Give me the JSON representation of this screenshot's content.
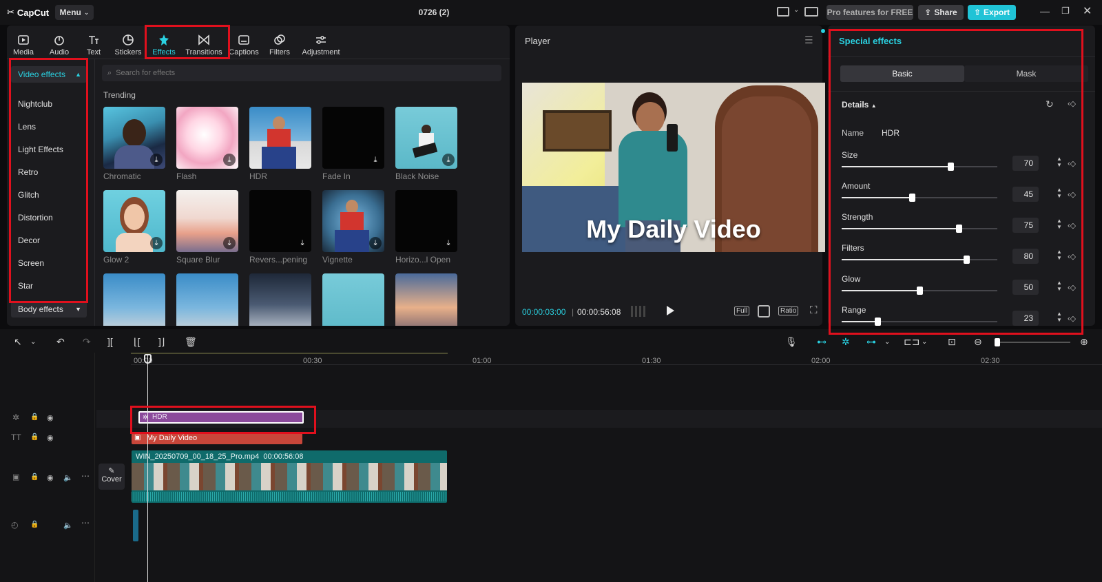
{
  "app": {
    "name": "CapCut",
    "menu_label": "Menu",
    "project_title": "0726 (2)"
  },
  "header": {
    "pro_label": "Pro features for FREE",
    "share_label": "Share",
    "export_label": "Export"
  },
  "toolbar": {
    "tabs": [
      {
        "label": "Media",
        "icon": "media-icon"
      },
      {
        "label": "Audio",
        "icon": "audio-icon"
      },
      {
        "label": "Text",
        "icon": "text-icon"
      },
      {
        "label": "Stickers",
        "icon": "sticker-icon"
      },
      {
        "label": "Effects",
        "icon": "effects-icon",
        "active": true
      },
      {
        "label": "Transitions",
        "icon": "transitions-icon"
      },
      {
        "label": "Captions",
        "icon": "captions-icon"
      },
      {
        "label": "Filters",
        "icon": "filters-icon"
      },
      {
        "label": "Adjustment",
        "icon": "adjustment-icon"
      }
    ]
  },
  "sidebar": {
    "video_effects_label": "Video effects",
    "items": [
      "Nightclub",
      "Lens",
      "Light Effects",
      "Retro",
      "Glitch",
      "Distortion",
      "Decor",
      "Screen",
      "Star"
    ],
    "body_effects_label": "Body effects"
  },
  "effects": {
    "search_placeholder": "Search for effects",
    "section_label": "Trending",
    "items": [
      "Chromatic",
      "Flash",
      "HDR",
      "Fade In",
      "Black Noise",
      "Glow 2",
      "Square Blur",
      "Revers...pening",
      "Vignette",
      "Horizo...l Open"
    ]
  },
  "player": {
    "title": "Player",
    "overlay_text": "My Daily Video",
    "current_time": "00:00:03:00",
    "total_time": "00:00:56:08",
    "full_label": "Full",
    "ratio_label": "Ratio"
  },
  "props": {
    "title": "Special effects",
    "tab_basic": "Basic",
    "tab_mask": "Mask",
    "details_label": "Details",
    "name_label": "Name",
    "name_value": "HDR",
    "sliders": [
      {
        "label": "Size",
        "value": "70",
        "level": 70
      },
      {
        "label": "Amount",
        "value": "45",
        "level": 45
      },
      {
        "label": "Strength",
        "value": "75",
        "level": 75
      },
      {
        "label": "Filters",
        "value": "80",
        "level": 80
      },
      {
        "label": "Glow",
        "value": "50",
        "level": 50
      },
      {
        "label": "Range",
        "value": "23",
        "level": 23
      }
    ]
  },
  "timeline": {
    "ruler": [
      "00:00",
      "00:30",
      "01:00",
      "01:30",
      "02:00",
      "02:30"
    ],
    "effect_clip": "HDR",
    "text_clip": "My Daily Video",
    "video_clip_name": "WIN_20250709_00_18_25_Pro.mp4",
    "video_clip_duration": "00:00:56:08",
    "cover_label": "Cover"
  },
  "colors": {
    "accent": "#2ad1e1",
    "highlight": "#e0101d",
    "effect_clip": "#8b4a9b",
    "text_clip": "#c8463a",
    "video_clip": "#0f6b6b"
  }
}
